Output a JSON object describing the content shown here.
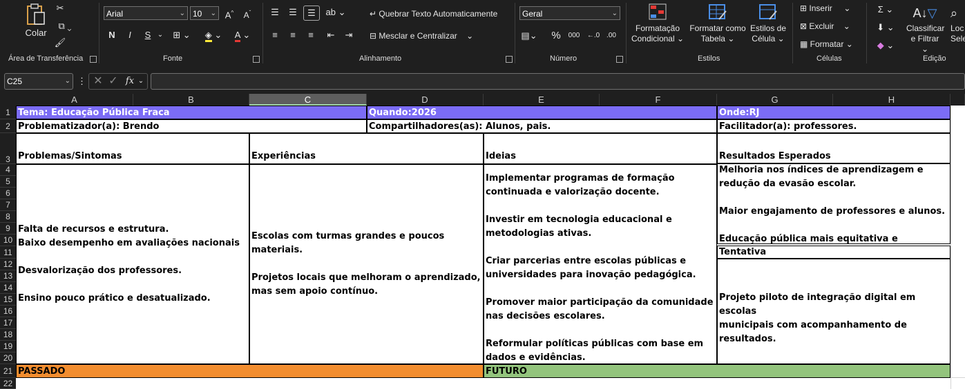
{
  "ribbon": {
    "clipboard": {
      "paste": "Colar",
      "label": "Área de Transferência"
    },
    "font": {
      "name": "Arial",
      "size": "10",
      "bold": "N",
      "italic": "I",
      "underline": "S",
      "label": "Fonte"
    },
    "alignment": {
      "wrap": "Quebrar Texto Automaticamente",
      "merge": "Mesclar e Centralizar",
      "label": "Alinhamento"
    },
    "number": {
      "format": "Geral",
      "percent": "%",
      "thousands": "000",
      "label": "Número"
    },
    "styles": {
      "cond_format": [
        "Formatação",
        "Condicional"
      ],
      "table_format": [
        "Formatar como",
        "Tabela"
      ],
      "cell_styles": [
        "Estilos de",
        "Célula"
      ],
      "label": "Estilos"
    },
    "cells": {
      "insert": "Inserir",
      "delete": "Excluir",
      "format": "Formatar",
      "label": "Células"
    },
    "editing": {
      "sort": [
        "Classificar",
        "e Filtrar"
      ],
      "find": [
        "Loc",
        "Sele"
      ],
      "label": "Edição"
    }
  },
  "formula_bar": {
    "name_box": "C25",
    "fx": "fx",
    "value": ""
  },
  "columns": [
    "A",
    "B",
    "C",
    "D",
    "E",
    "F",
    "G",
    "H"
  ],
  "rows": [
    "1",
    "2",
    "3",
    "4",
    "5",
    "6",
    "7",
    "8",
    "9",
    "10",
    "11",
    "12",
    "13",
    "14",
    "15",
    "16",
    "17",
    "18",
    "19",
    "20",
    "21",
    "22"
  ],
  "cells": {
    "tema": "Tema: Educação Pública Fraca",
    "quando": "Quando:2026",
    "onde": "Onde:RJ",
    "problematizador": "Problematizador(a): Brendo",
    "compartilhadores": "Compartilhadores(as): Alunos, pais.",
    "facilitador": "Facilitador(a): professores.",
    "h_problemas": "Problemas/Sintomas",
    "h_experiencias": "Experiências",
    "h_ideias": "Ideias",
    "h_resultados": "Resultados Esperados",
    "problemas": "Falta de recursos e estrutura.\nBaixo desempenho em avaliações nacionais\n\nDesvalorização dos professores.\n\nEnsino pouco prático e desatualizado.",
    "experiencias": "Escolas com turmas grandes e poucos\nmateriais.\n\nProjetos locais que melhoram o aprendizado,\nmas sem apoio contínuo.",
    "ideias": "Implementar programas de formação\ncontinuada e valorização docente.\n\nInvestir em tecnologia educacional e\nmetodologias ativas.\n\nCriar parcerias entre escolas públicas e\nuniversidades para inovação pedagógica.\n\nPromover maior participação da comunidade\nnas decisões escolares.\n\nReformular políticas públicas com base em\ndados e evidências.",
    "resultados": "Melhoria nos índices de aprendizagem e\nredução da evasão escolar.\n\nMaior engajamento de professores e alunos.\n\nEducação pública mais equitativa e moderna.",
    "tentativa": "Tentativa",
    "projeto": "Projeto piloto de integração digital em escolas\nmunicipais com acompanhamento de\nresultados.",
    "passado": "PASSADO",
    "futuro": "FUTURO"
  },
  "colors": {
    "header_purple": "#7b6cf6",
    "passado_orange": "#f28d2f",
    "futuro_green": "#93c47d"
  }
}
